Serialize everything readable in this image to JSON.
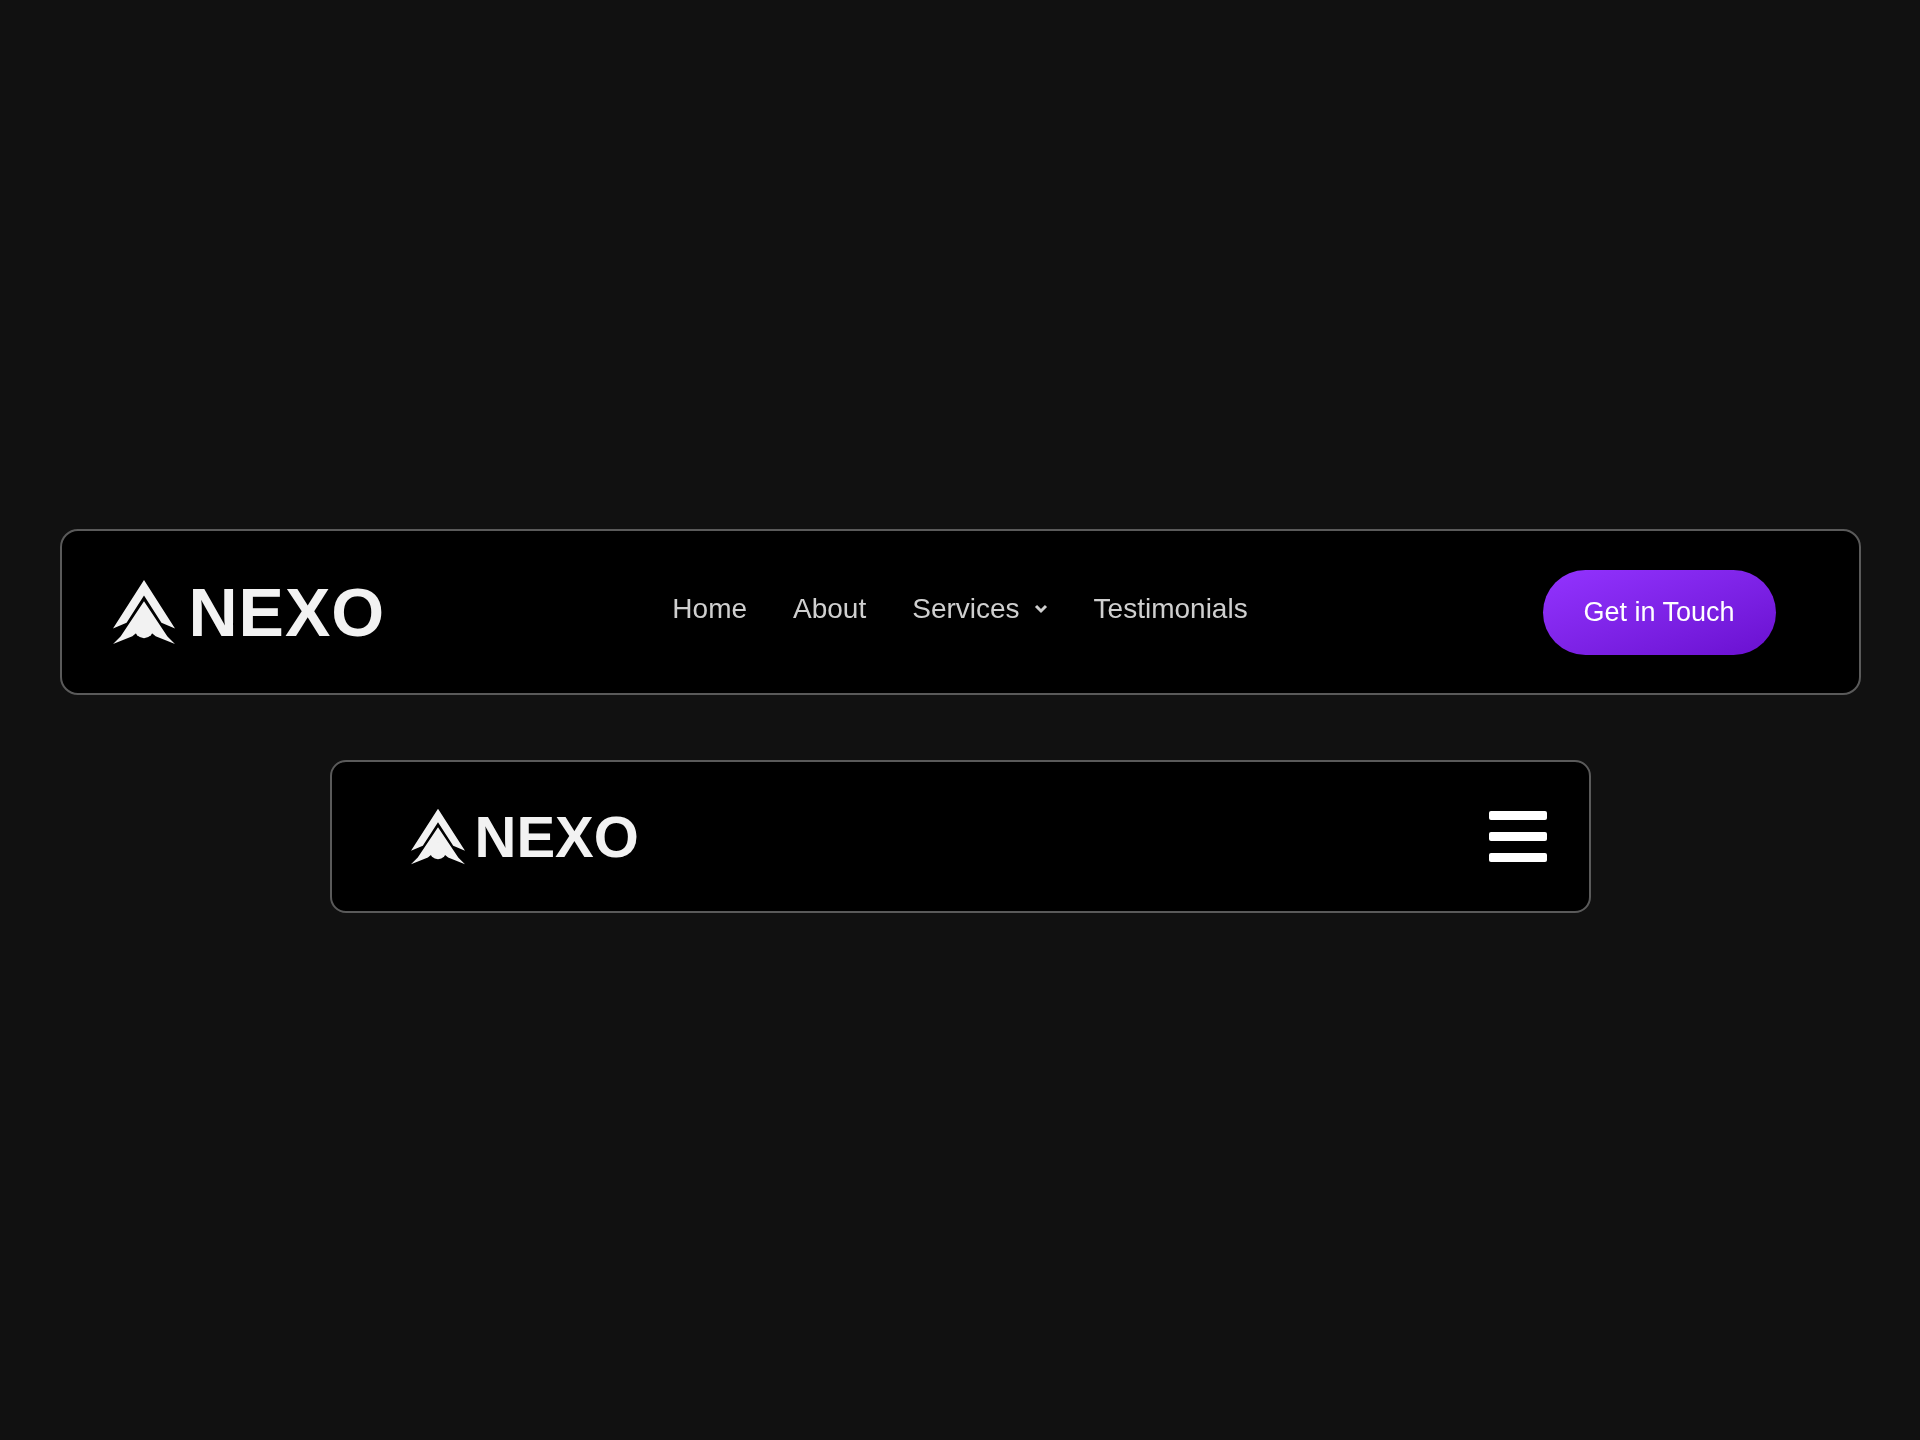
{
  "desktop_navbar": {
    "logo": "NEXO",
    "links": [
      {
        "label": "Home",
        "kind": "link"
      },
      {
        "label": "About",
        "kind": "link"
      },
      {
        "label": "Services",
        "kind": "dropdown"
      },
      {
        "label": "Testimonials",
        "kind": "link"
      }
    ],
    "button": "Get in Touch"
  },
  "mobile_navbar": {
    "logo": "NEXO"
  }
}
